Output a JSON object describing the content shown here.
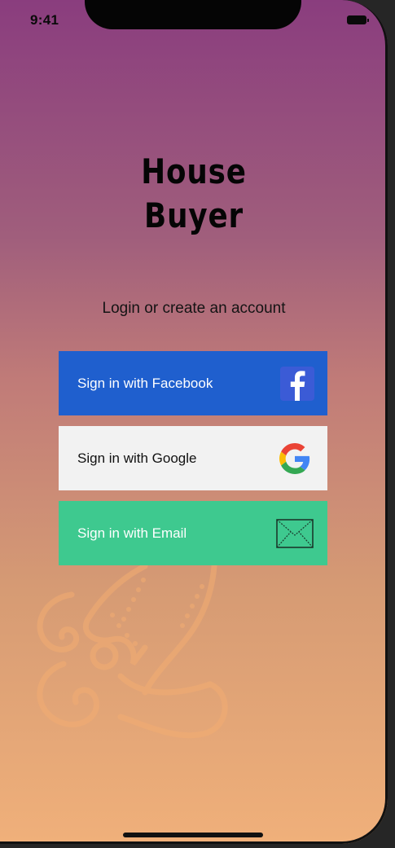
{
  "status_bar": {
    "time": "9:41"
  },
  "app": {
    "title_line1": "House",
    "title_line2": "Buyer",
    "subtitle": "Login or create an account"
  },
  "buttons": {
    "facebook": {
      "label": "Sign in with Facebook",
      "icon": "facebook-icon",
      "color": "#1f5fce"
    },
    "google": {
      "label": "Sign in with Google",
      "icon": "google-icon",
      "color": "#f2f2f2"
    },
    "email": {
      "label": "Sign in with Email",
      "icon": "mail-icon",
      "color": "#3ec98f"
    }
  },
  "colors": {
    "gradient_top": "#8a3d7e",
    "gradient_bottom": "#f0b07a"
  }
}
